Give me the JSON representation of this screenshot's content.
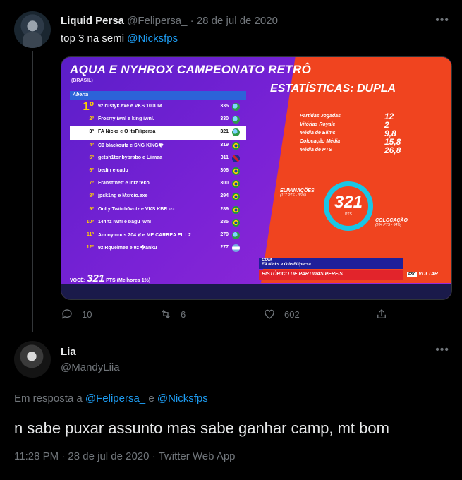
{
  "tweet1": {
    "name": "Liquid Persa",
    "handle": "@Felipersa_",
    "sep": "·",
    "date": "28 de jul de 2020",
    "text_prefix": "top 3 na semi ",
    "mention": "@Nicksfps",
    "actions": {
      "replies": "10",
      "retweets": "6",
      "likes": "602"
    },
    "image": {
      "title": "AQUA E NYHROX CAMPEONATO RETRÔ",
      "region": "(BRASIL)",
      "tab": "Aberta",
      "rows": [
        {
          "rank": "1º",
          "name": "9z rustyk.exe e VKS 100UM",
          "pts": "335",
          "flag": "world"
        },
        {
          "rank": "2º",
          "name": "Frosrry iwnl e king iwnl.",
          "pts": "330",
          "flag": "world"
        },
        {
          "rank": "3º",
          "name": "FA Nicks e O ItsFilipersa",
          "pts": "321",
          "flag": "world"
        },
        {
          "rank": "4º",
          "name": "C9 blackoutz e SNG KING�",
          "pts": "319",
          "flag": "brazil"
        },
        {
          "rank": "5º",
          "name": "getsh1tonbybrabo e Liimaa",
          "pts": "311",
          "flag": "uk"
        },
        {
          "rank": "6º",
          "name": "bedin e cadu",
          "pts": "306",
          "flag": "brazil"
        },
        {
          "rank": "7º",
          "name": "Fransttheff e intz teko",
          "pts": "300",
          "flag": "brazil"
        },
        {
          "rank": "8º",
          "name": "jpsk1ng e Mxrcio.exe",
          "pts": "294",
          "flag": "brazil"
        },
        {
          "rank": "9º",
          "name": "OnLy Twitch0votz e VKS KBR -ε-",
          "pts": "289",
          "flag": "brazil"
        },
        {
          "rank": "10º",
          "name": "144hz iwnl e bagu iwnl",
          "pts": "285",
          "flag": "brazil"
        },
        {
          "rank": "11º",
          "name": "Anonymous 204 ສ e ME CARREA EL L2",
          "pts": "279",
          "flag": "world"
        },
        {
          "rank": "12º",
          "name": "9z Rquelmee e 9z �anku",
          "pts": "277",
          "flag": "argentina"
        }
      ],
      "you_label": "VOCÊ:",
      "you_pts": "321",
      "you_unit": "PTS",
      "you_best": "(Melhores 1%)",
      "stats_title": "ESTATÍSTICAS: DUPLA",
      "stats": [
        {
          "label": "Partidas Jogadas",
          "value": "12"
        },
        {
          "label": "Vitórias Royale",
          "value": "2"
        },
        {
          "label": "Média de Elims",
          "value": "9,8"
        },
        {
          "label": "Colocação Média",
          "value": "15,8"
        },
        {
          "label": "Média de PTS",
          "value": "26,8"
        }
      ],
      "ring_value": "321",
      "ring_unit": "PTS",
      "elims_label": "ELIMINAÇÕES",
      "elims_sub": "(117 PTS - 36%)",
      "placement_label": "COLOCAÇÃO",
      "placement_sub": "(204 PTS - 64%)",
      "team_prefix": "COM",
      "team_name": "FA Nicks e O ItsFilipersa",
      "history": "HISTÓRICO DE PARTIDAS   PERFIS",
      "back": "VOLTAR",
      "back_key": "ESC"
    }
  },
  "tweet2": {
    "name": "Lia",
    "handle": "@MandyLiia",
    "reply_prefix": "Em resposta a ",
    "reply_user1": "@Felipersa_",
    "reply_and": " e ",
    "reply_user2": "@Nicksfps",
    "text": "n sabe puxar assunto mas sabe ganhar camp, mt bom",
    "time": "11:28 PM · 28 de jul de 2020 · Twitter Web App"
  },
  "colors": {
    "background": "#000000",
    "accent": "#1d9bf0",
    "muted": "#71767b",
    "divider": "#2f3336"
  }
}
